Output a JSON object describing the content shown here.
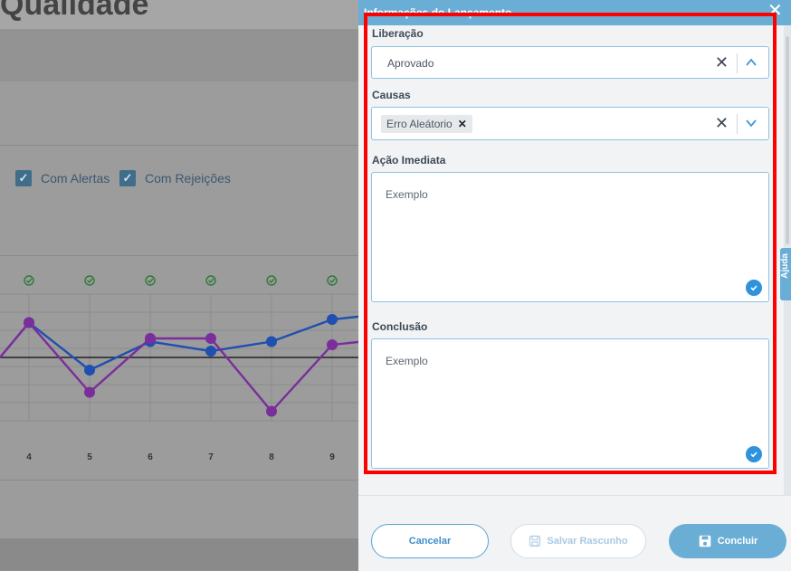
{
  "background": {
    "page_title": "Qualidade",
    "checkboxes": [
      {
        "label": "Com Alertas",
        "checked": true
      },
      {
        "label": "Com Rejeições",
        "checked": true
      }
    ],
    "chart_data": {
      "type": "line",
      "x": [
        "4",
        "5",
        "6",
        "7",
        "8",
        "9"
      ],
      "series": [
        {
          "color": "#1f4fb0",
          "values": [
            3.1,
            1.6,
            2.5,
            2.2,
            2.5,
            3.2
          ]
        },
        {
          "color": "#7a2e9c",
          "values": [
            3.1,
            0.9,
            2.6,
            2.6,
            0.3,
            2.4
          ]
        }
      ],
      "reference_line": 2.0,
      "alert_marker": "check-circle-icon"
    }
  },
  "drawer": {
    "title": "Informações do Lançamento",
    "close_icon": "close-icon",
    "liberacao": {
      "label": "Liberação",
      "value": "Aprovado"
    },
    "causas": {
      "label": "Causas",
      "tags": [
        "Erro Aleátorio"
      ]
    },
    "acao_imediata": {
      "label": "Ação Imediata",
      "value": "Exemplo"
    },
    "conclusao": {
      "label": "Conclusão",
      "value": "Exemplo"
    },
    "buttons": {
      "cancel": "Cancelar",
      "draft": "Salvar Rascunho",
      "confirm": "Concluir"
    },
    "help_tab": "Ajuda"
  },
  "colors": {
    "accent": "#6aaed6",
    "highlight": "#ff0000"
  }
}
